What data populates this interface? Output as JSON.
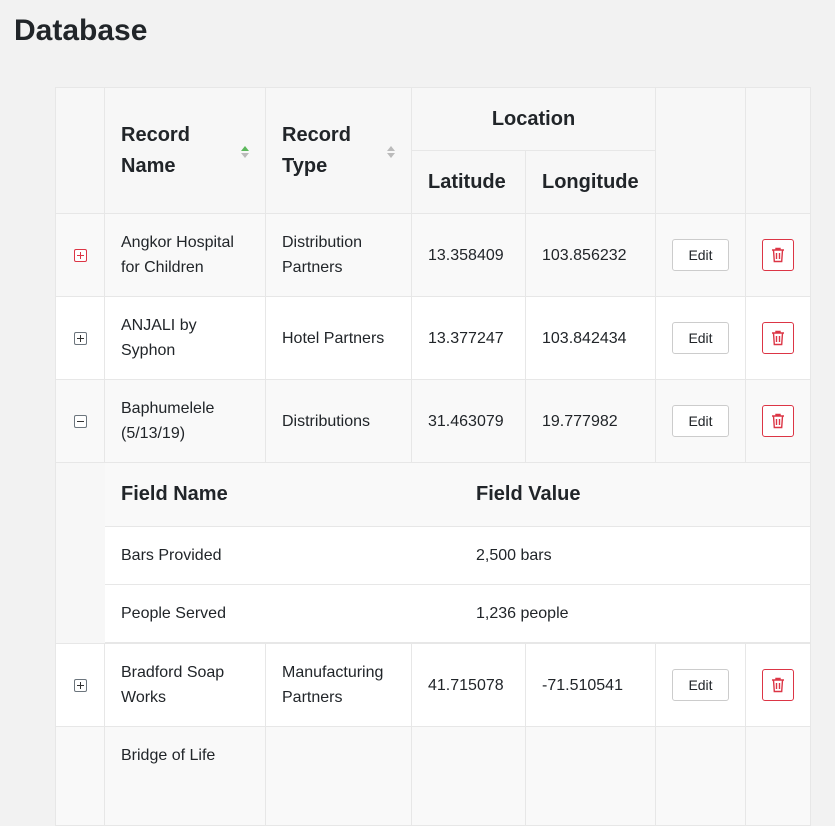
{
  "page": {
    "title": "Database"
  },
  "table": {
    "headers": {
      "record_name": "Record Name",
      "record_type": "Record Type",
      "location": "Location",
      "latitude": "Latitude",
      "longitude": "Longitude"
    },
    "edit_label": "Edit",
    "rows": [
      {
        "name": "Angkor Hospital for Children",
        "type": "Distribution Partners",
        "latitude": "13.358409",
        "longitude": "103.856232",
        "expanded": false
      },
      {
        "name": "ANJALI by Syphon",
        "type": "Hotel Partners",
        "latitude": "13.377247",
        "longitude": "103.842434",
        "expanded": false
      },
      {
        "name": "Baphumelele (5/13/19)",
        "type": "Distributions",
        "latitude": "31.463079",
        "longitude": "19.777982",
        "expanded": true
      },
      {
        "name": "Bradford Soap Works",
        "type": "Manufacturing Partners",
        "latitude": "41.715078",
        "longitude": "-71.510541",
        "expanded": false
      },
      {
        "name": "Bridge of Life",
        "type": "",
        "latitude": "",
        "longitude": "",
        "expanded": false
      }
    ],
    "detail": {
      "field_name_header": "Field Name",
      "field_value_header": "Field Value",
      "fields": [
        {
          "name": "Bars Provided",
          "value": "2,500 bars"
        },
        {
          "name": "People Served",
          "value": "1,236 people"
        }
      ]
    }
  },
  "icons": {
    "expand": "plus-square-icon",
    "collapse": "minus-square-icon",
    "delete": "trash-icon",
    "sort": "sort-icon"
  },
  "colors": {
    "danger": "#dc3545",
    "sort_active": "#5cb85c",
    "background": "#f2f2f2"
  }
}
